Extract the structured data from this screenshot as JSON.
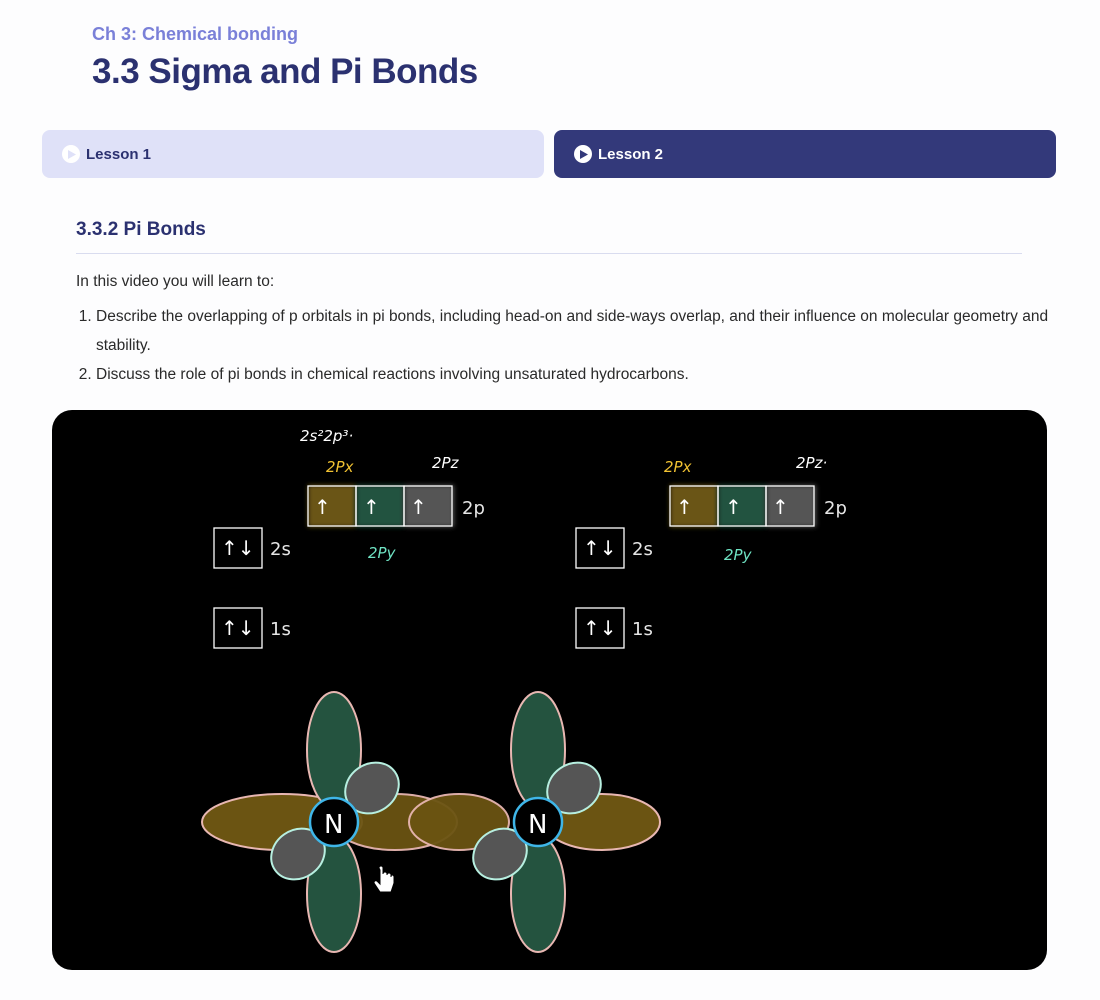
{
  "breadcrumb": {
    "chapter": "Ch 3:  Chemical bonding"
  },
  "page": {
    "title": "3.3  Sigma and Pi Bonds"
  },
  "tabs": [
    {
      "label": "Lesson 1",
      "active": false
    },
    {
      "label": "Lesson 2",
      "active": true
    }
  ],
  "section": {
    "title": "3.3.2  Pi Bonds",
    "intro": "In this video you will learn to:",
    "objectives": [
      "Describe the overlapping of p orbitals in pi bonds, including head-on and side-ways overlap, and their influence on molecular geometry and stability.",
      "Discuss the role of pi bonds in chemical reactions involving unsaturated hydrocarbons."
    ]
  },
  "video": {
    "diagram_left": {
      "electron_config_note": "2s²2p³·",
      "orbital_2s": {
        "arrows": "↑↓",
        "label": "2s"
      },
      "orbital_1s": {
        "arrows": "↑↓",
        "label": "1s"
      },
      "orbital_2p": {
        "arrows": [
          "↑",
          "↑",
          "↑"
        ],
        "label": "2p"
      },
      "notes": {
        "px": "2Px",
        "pz": "2Pz",
        "py": "2Py"
      }
    },
    "diagram_right": {
      "orbital_2s": {
        "arrows": "↑↓",
        "label": "2s"
      },
      "orbital_1s": {
        "arrows": "↑↓",
        "label": "1s"
      },
      "orbital_2p": {
        "arrows": [
          "↑",
          "↑",
          "↑"
        ],
        "label": "2p"
      },
      "notes": {
        "px": "2Px",
        "pz": "2Pz·",
        "py": "2Py"
      }
    },
    "atoms": [
      "N",
      "N"
    ],
    "colors": {
      "px": "#6b5412",
      "py": "#24533f",
      "pz": "#555555",
      "outline_px": "#e8b7b2",
      "outline_py": "#b7efe0",
      "nucleus": "#3fb6e8",
      "note_yellow": "#f1c232",
      "note_teal": "#6fe3c3"
    }
  }
}
